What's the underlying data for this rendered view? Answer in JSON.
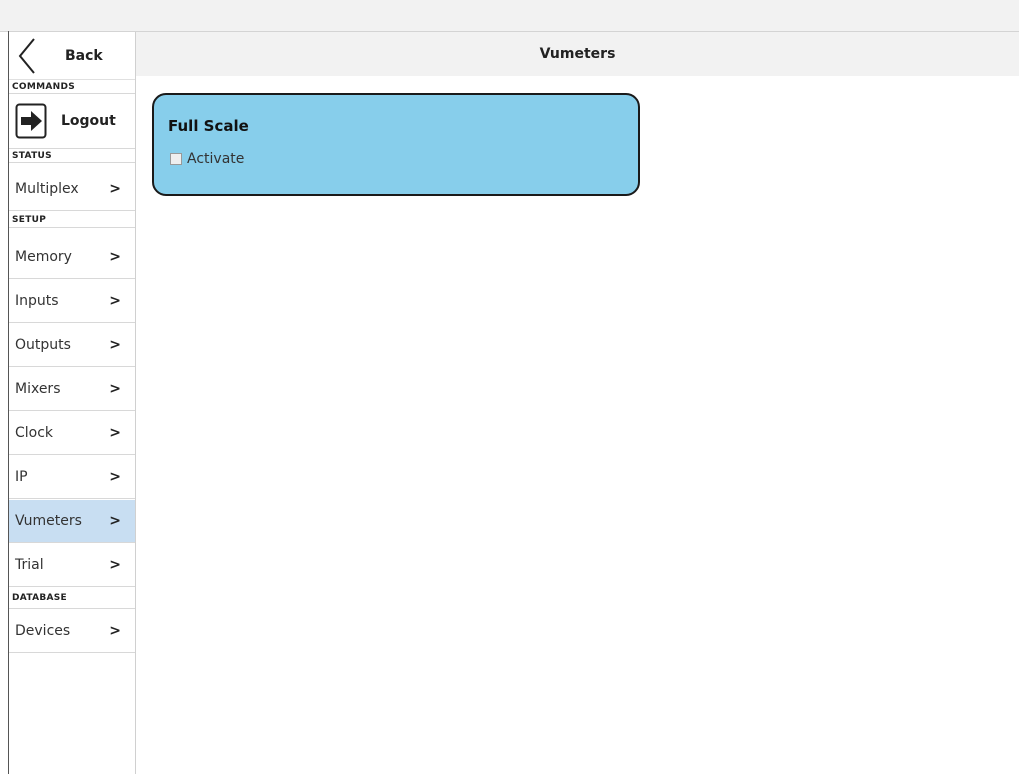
{
  "header": {
    "title": "Vumeters"
  },
  "sidebar": {
    "back_label": "Back",
    "sections": {
      "commands": "COMMANDS",
      "status": "STATUS",
      "setup": "SETUP",
      "database": "DATABASE"
    },
    "logout_label": "Logout",
    "items": [
      {
        "label": "Multiplex"
      },
      {
        "label": "Memory"
      },
      {
        "label": "Inputs"
      },
      {
        "label": "Outputs"
      },
      {
        "label": "Mixers"
      },
      {
        "label": "Clock"
      },
      {
        "label": "IP"
      },
      {
        "label": "Vumeters",
        "active": true
      },
      {
        "label": "Trial"
      },
      {
        "label": "Devices"
      }
    ]
  },
  "panel": {
    "title": "Full Scale",
    "checkbox_label": "Activate",
    "checked": false
  },
  "colors": {
    "accent_card": "#87ceeb",
    "active_item": "#c8def2"
  },
  "icons": {
    "back": "chevron-left-icon",
    "logout": "logout-arrow-icon",
    "item_arrow": "chevron-right-icon"
  }
}
